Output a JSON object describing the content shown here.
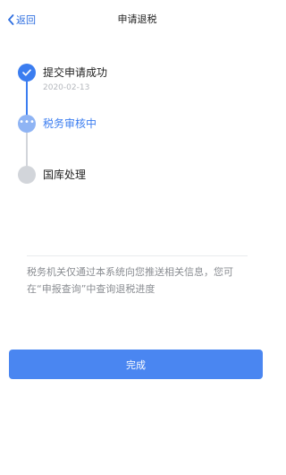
{
  "nav": {
    "back_label": "返回",
    "title": "申请退税"
  },
  "timeline": {
    "steps": [
      {
        "label": "提交申请成功",
        "date": "2020-02-13",
        "status": "done"
      },
      {
        "label": "税务审核中",
        "status": "active"
      },
      {
        "label": "国库处理",
        "status": "pending"
      }
    ],
    "active_dots": "•••"
  },
  "notice": {
    "text": "税务机关仅通过本系统向您推送相关信息，您可在“申报查询”中查询退税进度"
  },
  "actions": {
    "done_label": "完成"
  },
  "colors": {
    "accent": "#3b7df0",
    "button": "#4a86f1",
    "pending": "#d2d5da",
    "muted_text": "#8a8d92"
  },
  "icons": {
    "back": "chevron-left-icon",
    "step_done": "check-icon",
    "step_active": "more-dots-icon",
    "step_pending": "empty-circle-icon"
  }
}
